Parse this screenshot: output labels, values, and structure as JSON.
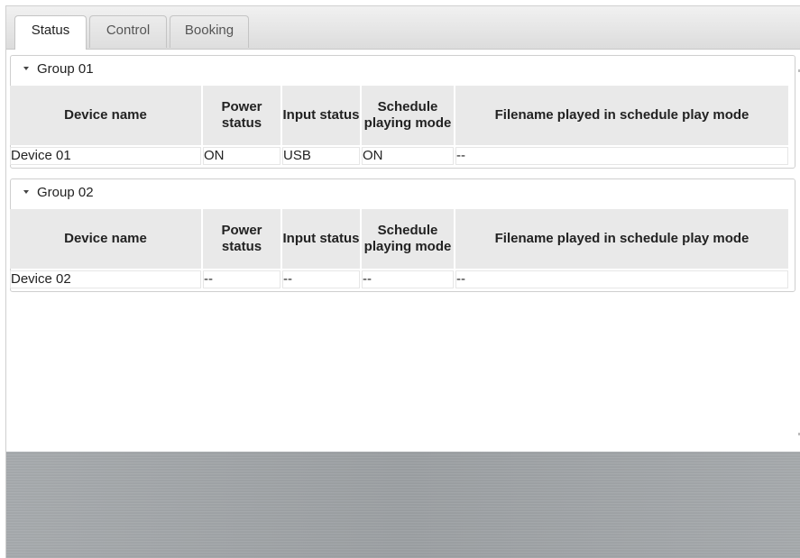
{
  "tabs": [
    {
      "label": "Status",
      "active": true
    },
    {
      "label": "Control",
      "active": false
    },
    {
      "label": "Booking",
      "active": false
    }
  ],
  "columns": {
    "device_name": "Device name",
    "power_status": "Power status",
    "input_status": "Input status",
    "schedule_mode": "Schedule playing mode",
    "filename": "Filename played in schedule play mode"
  },
  "groups": [
    {
      "title": "Group 01",
      "expanded": true,
      "rows": [
        {
          "device_name": "Device 01",
          "power_status": "ON",
          "input_status": "USB",
          "schedule_mode": "ON",
          "filename": "--"
        }
      ]
    },
    {
      "title": "Group 02",
      "expanded": true,
      "rows": [
        {
          "device_name": "Device 02",
          "power_status": "--",
          "input_status": "--",
          "schedule_mode": "--",
          "filename": "--"
        }
      ]
    }
  ],
  "colors": {
    "header_bg": "#e9e9e9",
    "footer_bg": "#a3a7aa"
  }
}
